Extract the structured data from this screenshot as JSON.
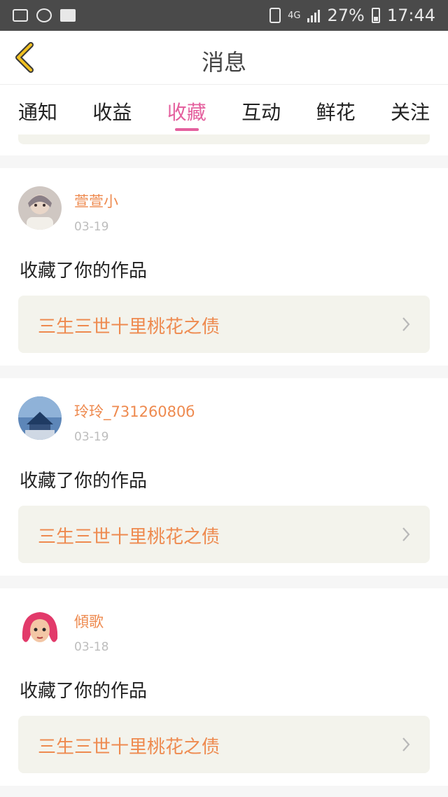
{
  "status_bar": {
    "network": "4G",
    "battery": "27%",
    "time": "17:44"
  },
  "header": {
    "title": "消息"
  },
  "tabs": [
    {
      "label": "通知",
      "active": false
    },
    {
      "label": "收益",
      "active": false
    },
    {
      "label": "收藏",
      "active": true
    },
    {
      "label": "互动",
      "active": false
    },
    {
      "label": "鲜花",
      "active": false
    },
    {
      "label": "关注",
      "active": false
    }
  ],
  "messages": [
    {
      "username": "萱萱小",
      "date": "03-19",
      "action": "收藏了你的作品",
      "work_title": "三生三世十里桃花之债"
    },
    {
      "username": "玲玲_73126080б",
      "date": "03-19",
      "action": "收藏了你的作品",
      "work_title": "三生三世十里桃花之债"
    },
    {
      "username": "傾歌",
      "date": "03-18",
      "action": "收藏了你的作品",
      "work_title": "三生三世十里桃花之债"
    }
  ],
  "colors": {
    "accent": "#e4609e",
    "username": "#ee8a4f",
    "back_arrow": "#f0c020"
  }
}
